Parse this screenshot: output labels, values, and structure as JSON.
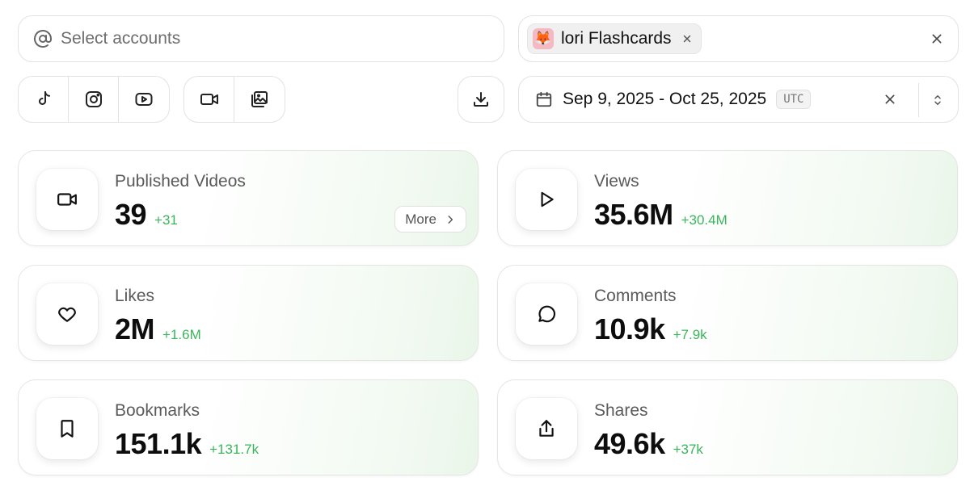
{
  "accounts": {
    "placeholder": "Select accounts",
    "icon": "at-icon"
  },
  "selected_account": {
    "name": "lori Flashcards",
    "avatar": "🦊"
  },
  "platforms": [
    "tiktok-icon",
    "instagram-icon",
    "youtube-icon"
  ],
  "content_types": [
    "video-icon",
    "image-gallery-icon"
  ],
  "download": {
    "icon": "download-icon"
  },
  "date_range": {
    "text": "Sep 9, 2025 - Oct 25, 2025",
    "timezone": "UTC"
  },
  "stats": {
    "published_videos": {
      "label": "Published Videos",
      "value": "39",
      "delta": "+31",
      "more": "More"
    },
    "views": {
      "label": "Views",
      "value": "35.6M",
      "delta": "+30.4M"
    },
    "likes": {
      "label": "Likes",
      "value": "2M",
      "delta": "+1.6M"
    },
    "comments": {
      "label": "Comments",
      "value": "10.9k",
      "delta": "+7.9k"
    },
    "bookmarks": {
      "label": "Bookmarks",
      "value": "151.1k",
      "delta": "+131.7k"
    },
    "shares": {
      "label": "Shares",
      "value": "49.6k",
      "delta": "+37k"
    }
  },
  "colors": {
    "delta_green": "#3bb55b",
    "border": "#e2e2e2"
  }
}
